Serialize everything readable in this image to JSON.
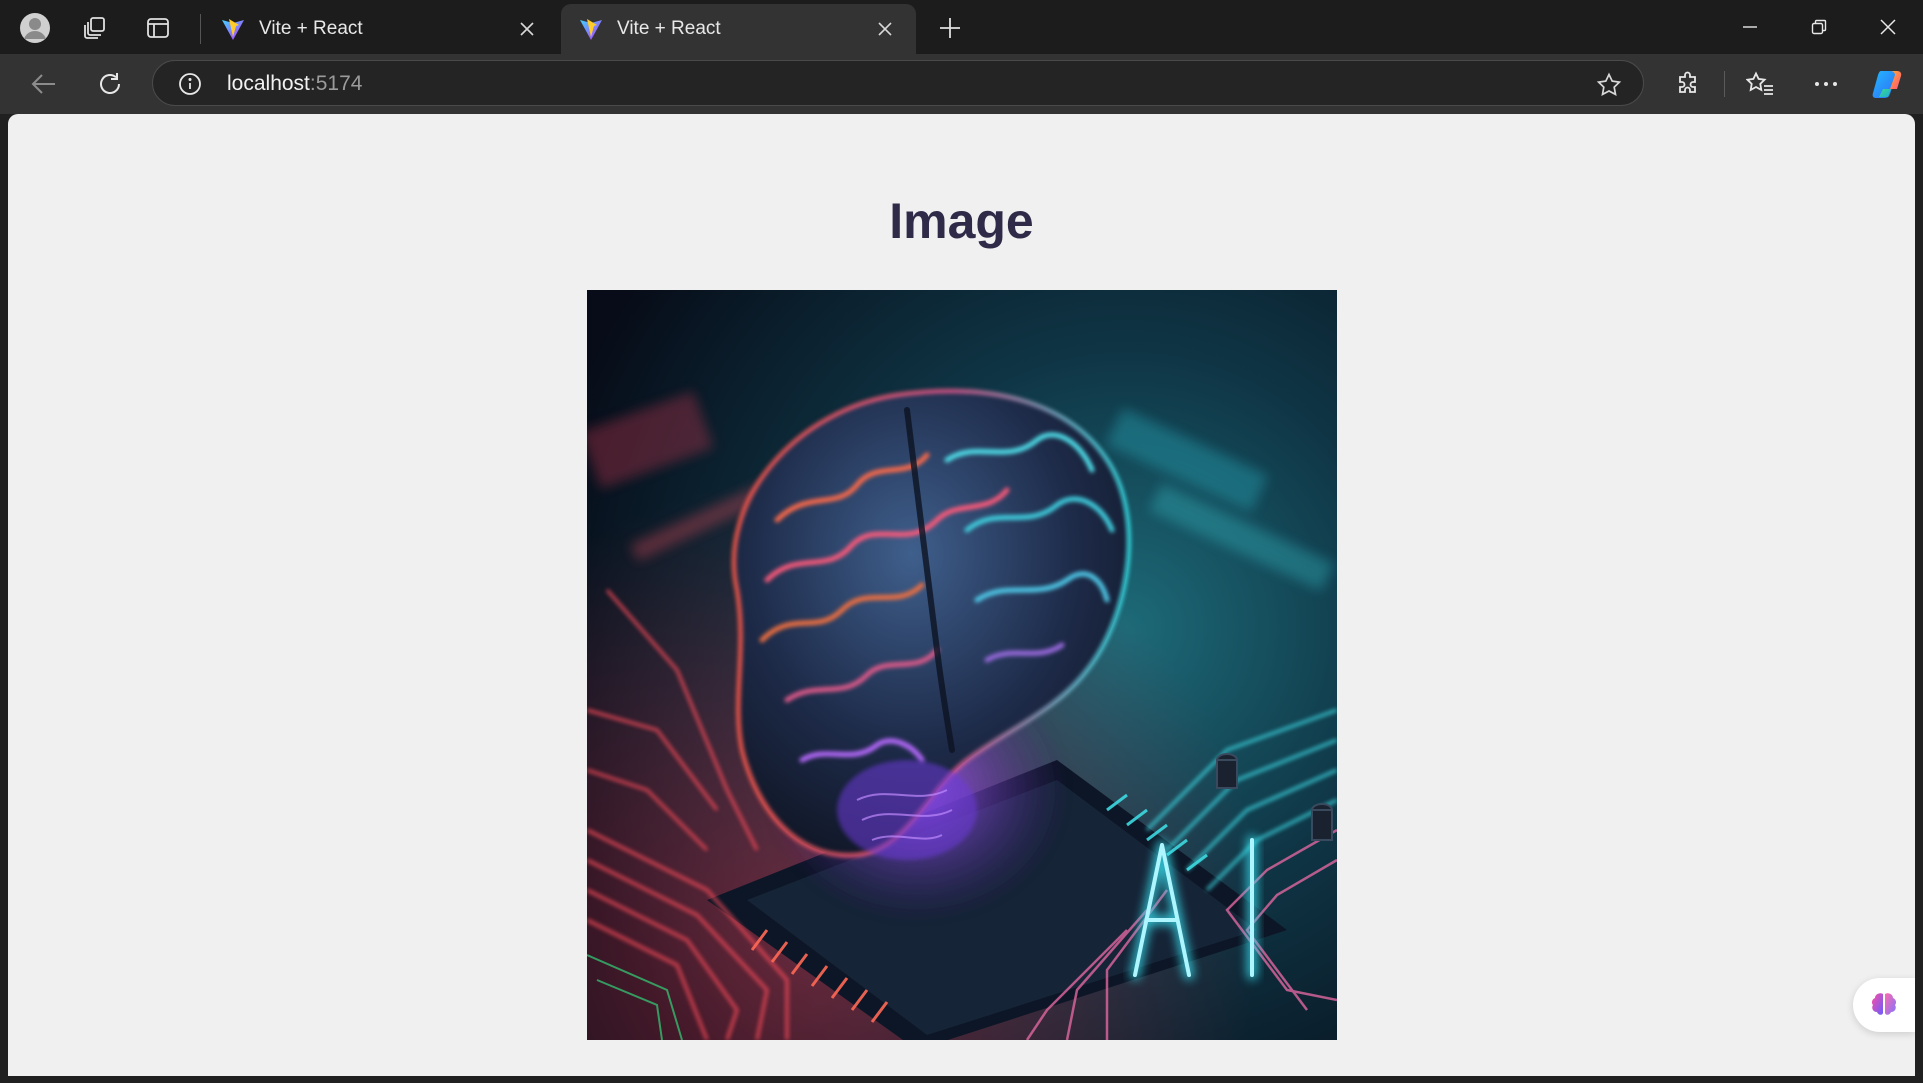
{
  "browser": {
    "tabs": [
      {
        "title": "Vite + React",
        "active": false
      },
      {
        "title": "Vite + React",
        "active": true
      }
    ],
    "address": {
      "host": "localhost",
      "port": ":5174"
    },
    "icons": {
      "profile": "profile-avatar-icon",
      "workspaces": "workspaces-icon",
      "tab_actions": "tab-actions-icon",
      "favicon": "vite-logo-icon",
      "close": "close-icon",
      "new_tab": "plus-icon",
      "minimize": "minimize-icon",
      "restore": "restore-icon",
      "close_window": "close-window-icon",
      "back": "back-arrow-icon",
      "refresh": "refresh-icon",
      "site_info": "info-icon",
      "favorite": "star-icon",
      "extensions": "puzzle-icon",
      "favorites": "favorites-icon",
      "menu": "more-icon",
      "copilot": "copilot-icon"
    }
  },
  "page": {
    "heading": "Image",
    "hero_image": {
      "subject": "glowing brain on circuit board",
      "overlay_text": "AI"
    },
    "side_widget_icon": "brain-icon"
  },
  "colors": {
    "heading": "#2f2a48",
    "page_bg": "#f0f0f0",
    "chrome_dark": "#1c1c1c",
    "toolbar": "#333333"
  }
}
